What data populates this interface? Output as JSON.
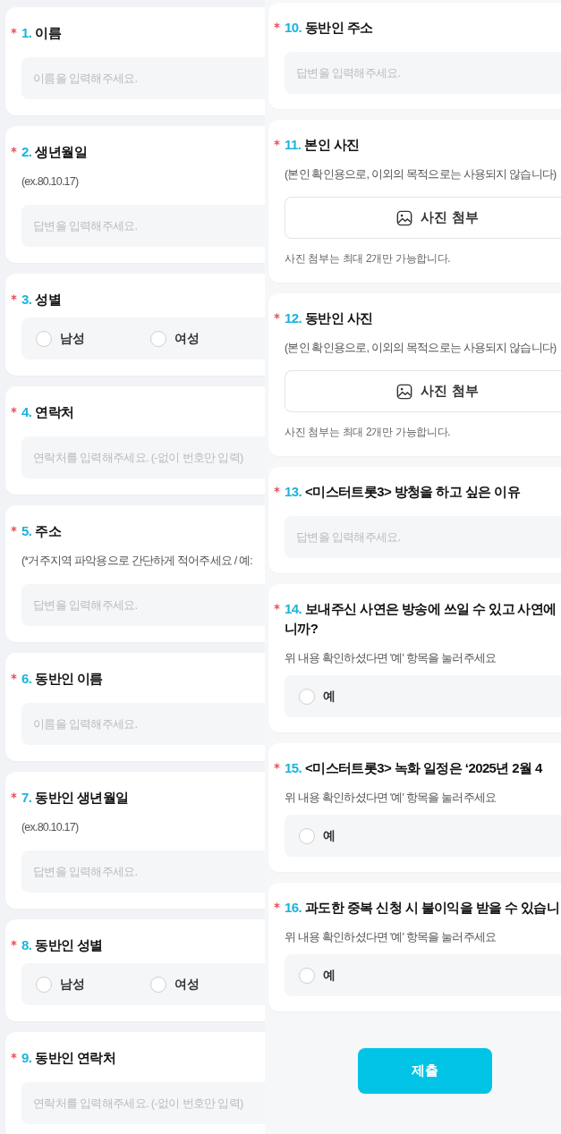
{
  "left_panel": {
    "questions": [
      {
        "kind": "text",
        "required": true,
        "number": "1.",
        "title": "이름",
        "placeholder": "이름을 입력해주세요."
      },
      {
        "kind": "text",
        "required": true,
        "number": "2.",
        "title": "생년월일",
        "hint": "(ex.80.10.17)",
        "placeholder": "답변을 입력해주세요."
      },
      {
        "kind": "choice",
        "required": true,
        "number": "3.",
        "title": "성별",
        "options": [
          {
            "label": "남성",
            "selected": false
          },
          {
            "label": "여성",
            "selected": false
          }
        ]
      },
      {
        "kind": "text",
        "required": true,
        "number": "4.",
        "title": "연락처",
        "placeholder": "연락처를 입력해주세요. (-없이 번호만 입력)"
      },
      {
        "kind": "text",
        "required": true,
        "number": "5.",
        "title": "주소",
        "hint": "(*거주지역 파악용으로 간단하게 적어주세요 / 예:",
        "placeholder": "답변을 입력해주세요."
      },
      {
        "kind": "text",
        "required": true,
        "number": "6.",
        "title": "동반인 이름",
        "placeholder": "이름을 입력해주세요."
      },
      {
        "kind": "text",
        "required": true,
        "number": "7.",
        "title": "동반인 생년월일",
        "hint": "(ex.80.10.17)",
        "placeholder": "답변을 입력해주세요."
      },
      {
        "kind": "choice",
        "required": true,
        "number": "8.",
        "title": "동반인 성별",
        "options": [
          {
            "label": "남성",
            "selected": false
          },
          {
            "label": "여성",
            "selected": false
          }
        ]
      },
      {
        "kind": "text",
        "required": true,
        "number": "9.",
        "title": "동반인 연락처",
        "placeholder": "연락처를 입력해주세요. (-없이 번호만 입력)"
      }
    ]
  },
  "right_panel": {
    "questions": [
      {
        "kind": "text",
        "required": true,
        "number": "10.",
        "title": "동반인 주소",
        "placeholder": "답변을 입력해주세요."
      },
      {
        "kind": "photo",
        "required": true,
        "number": "11.",
        "title": "본인 사진",
        "hint": "(본인 확인용으로, 이외의 목적으로는 사용되지 않습니다)",
        "button": "사진 첨부",
        "note": "사진 첨부는 최대 2개만 가능합니다."
      },
      {
        "kind": "photo",
        "required": true,
        "number": "12.",
        "title": "동반인 사진",
        "hint": "(본인 확인용으로, 이외의 목적으로는 사용되지 않습니다)",
        "button": "사진 첨부",
        "note": "사진 첨부는 최대 2개만 가능합니다."
      },
      {
        "kind": "text",
        "required": true,
        "number": "13.",
        "title": "<미스터트롯3> 방청을 하고 싶은 이유",
        "placeholder": "답변을 입력해주세요."
      },
      {
        "kind": "choice",
        "required": true,
        "number": "14.",
        "title": "보내주신 사연은 방송에 쓰일 수 있고 사연에",
        "title_continued": "니까?",
        "hint": "위 내용 확인하셨다면 '예' 항목을 눌러주세요",
        "options": [
          {
            "label": "예",
            "selected": false
          }
        ]
      },
      {
        "kind": "choice",
        "required": true,
        "number": "15.",
        "title": "<미스터트롯3> 녹화 일정은 ‘2025년 2월 4",
        "hint": "위 내용 확인하셨다면 '예' 항목을 눌러주세요",
        "options": [
          {
            "label": "예",
            "selected": false
          }
        ]
      },
      {
        "kind": "choice",
        "required": true,
        "number": "16.",
        "title": "과도한 중복 신청 시 불이익을 받을 수 있습니",
        "hint": "위 내용 확인하셨다면 '예' 항목을 눌러주세요",
        "options": [
          {
            "label": "예",
            "selected": false
          }
        ]
      }
    ],
    "submit_button": "제출"
  }
}
